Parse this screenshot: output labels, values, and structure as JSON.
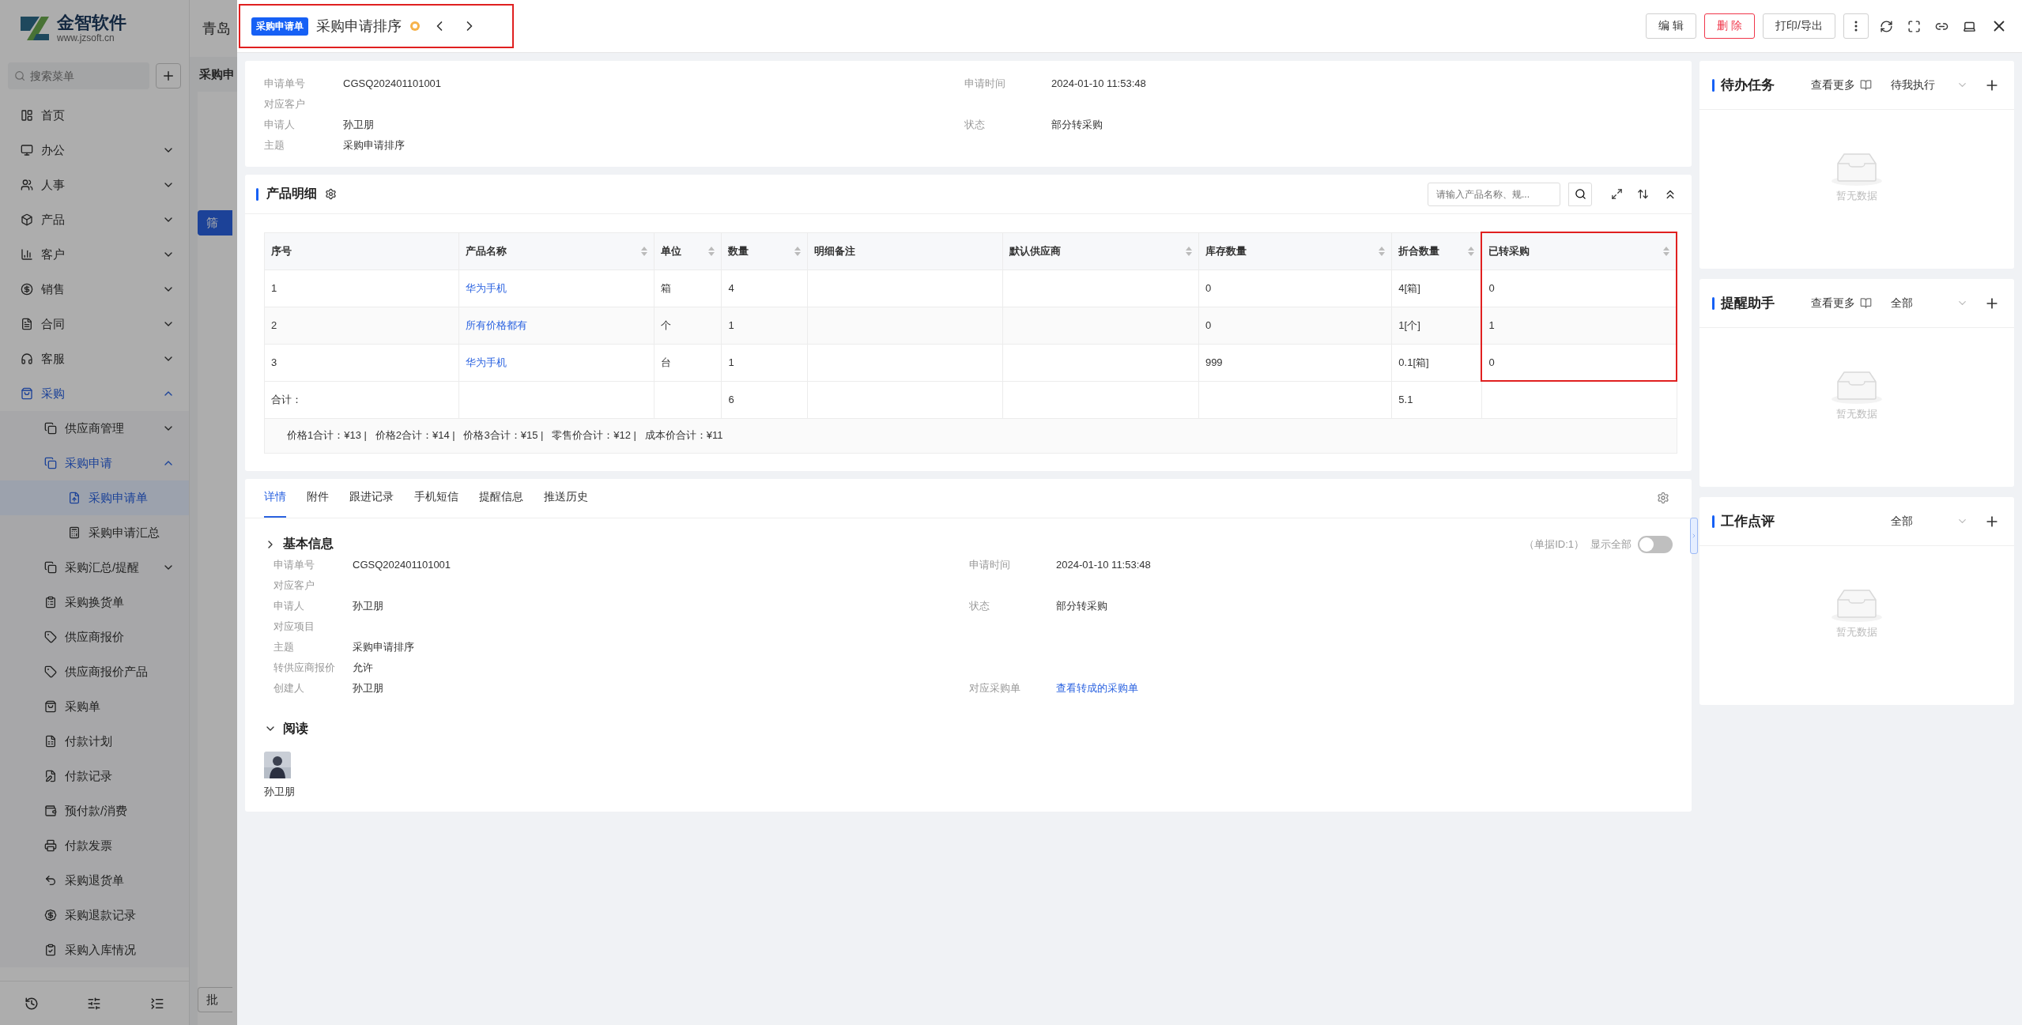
{
  "background_app": {
    "company": "青岛",
    "page_title": "采购申",
    "filter_button": "筛",
    "batch_button": "批"
  },
  "sidebar": {
    "logo": {
      "name": "金智软件",
      "url": "www.jzsoft.cn"
    },
    "search": {
      "placeholder": "搜索菜单"
    },
    "items": [
      {
        "label": "首页",
        "selected": false
      },
      {
        "label": "办公",
        "selected": false,
        "expanded": false
      },
      {
        "label": "人事",
        "selected": false,
        "expanded": false
      },
      {
        "label": "产品",
        "selected": false,
        "expanded": false
      },
      {
        "label": "客户",
        "selected": false,
        "expanded": false
      },
      {
        "label": "销售",
        "selected": false,
        "expanded": false
      },
      {
        "label": "合同",
        "selected": false,
        "expanded": false
      },
      {
        "label": "客服",
        "selected": false,
        "expanded": false
      },
      {
        "label": "采购",
        "selected": true,
        "expanded": true,
        "children": [
          {
            "label": "供应商管理",
            "selected": false,
            "expanded": false
          },
          {
            "label": "采购申请",
            "selected": true,
            "expanded": true,
            "children": [
              {
                "label": "采购申请单",
                "selected": true
              },
              {
                "label": "采购申请汇总",
                "selected": false
              }
            ]
          },
          {
            "label": "采购汇总/提醒",
            "selected": false,
            "expanded": false
          },
          {
            "label": "采购换货单",
            "selected": false
          },
          {
            "label": "供应商报价",
            "selected": false
          },
          {
            "label": "供应商报价产品",
            "selected": false
          },
          {
            "label": "采购单",
            "selected": false
          },
          {
            "label": "付款计划",
            "selected": false
          },
          {
            "label": "付款记录",
            "selected": false
          },
          {
            "label": "预付款/消费",
            "selected": false
          },
          {
            "label": "付款发票",
            "selected": false
          },
          {
            "label": "采购退货单",
            "selected": false
          },
          {
            "label": "采购退款记录",
            "selected": false
          },
          {
            "label": "采购入库情况",
            "selected": false
          }
        ]
      }
    ]
  },
  "header": {
    "highlighted": true,
    "tag": "采购申请单",
    "title": "采购申请排序",
    "buttons": [
      {
        "label": "编 辑",
        "kind": "default"
      },
      {
        "label": "删 除",
        "kind": "danger"
      },
      {
        "label": "打印/导出",
        "kind": "default"
      }
    ]
  },
  "summary": {
    "rows": [
      {
        "left": {
          "label": "申请单号",
          "value": "CGSQ202401101001"
        },
        "right": {
          "label": "申请时间",
          "value": "2024-01-10 11:53:48"
        }
      },
      {
        "left": {
          "label": "对应客户"
        }
      },
      {
        "left": {
          "label": "申请人",
          "value": "孙卫朋"
        },
        "right": {
          "label": "状态",
          "value": "部分转采购"
        }
      },
      {
        "left": {
          "label": "主题",
          "value": "采购申请排序"
        }
      }
    ]
  },
  "products": {
    "title": "产品明细",
    "search": {
      "placeholder": "请输入产品名称、规..."
    },
    "columns": [
      {
        "label": "序号",
        "sortable": false,
        "highlighted": false
      },
      {
        "label": "产品名称",
        "sortable": true,
        "highlighted": false,
        "kind": "link"
      },
      {
        "label": "单位",
        "sortable": true,
        "highlighted": false
      },
      {
        "label": "数量",
        "sortable": true,
        "highlighted": false,
        "total": "6"
      },
      {
        "label": "明细备注",
        "sortable": false,
        "highlighted": false
      },
      {
        "label": "默认供应商",
        "sortable": true,
        "highlighted": false
      },
      {
        "label": "库存数量",
        "sortable": true,
        "highlighted": false
      },
      {
        "label": "折合数量",
        "sortable": true,
        "highlighted": false,
        "total": "5.1"
      },
      {
        "label": "已转采购",
        "sortable": true,
        "highlighted": true
      }
    ],
    "rows": [
      [
        "1",
        "华为手机",
        "箱",
        "4",
        null,
        null,
        "0",
        "4[箱]",
        "0"
      ],
      [
        "2",
        "所有价格都有",
        "个",
        "1",
        null,
        null,
        "0",
        "1[个]",
        "1"
      ],
      [
        "3",
        "华为手机",
        "台",
        "1",
        null,
        null,
        "999",
        "0.1[箱]",
        "0"
      ]
    ],
    "total_label": "合计：",
    "price_totals": "价格1合计：¥13 |   价格2合计：¥14 |   价格3合计：¥15 |   零售价合计：¥12 |   成本价合计：¥11"
  },
  "tabs": [
    {
      "label": "详情",
      "selected": true
    },
    {
      "label": "附件",
      "selected": false
    },
    {
      "label": "跟进记录",
      "selected": false
    },
    {
      "label": "手机短信",
      "selected": false
    },
    {
      "label": "提醒信息",
      "selected": false
    },
    {
      "label": "推送历史",
      "selected": false
    }
  ],
  "basic_info": {
    "title": "基本信息",
    "expanded": false,
    "doc_id": "（单据ID:1）",
    "show_all": {
      "label": "显示全部",
      "on": false
    },
    "rows": [
      {
        "left": {
          "label": "申请单号",
          "value": "CGSQ202401101001"
        },
        "right": {
          "label": "申请时间",
          "value": "2024-01-10 11:53:48"
        }
      },
      {
        "left": {
          "label": "对应客户"
        }
      },
      {
        "left": {
          "label": "申请人",
          "value": "孙卫朋"
        },
        "right": {
          "label": "状态",
          "value": "部分转采购"
        }
      },
      {
        "left": {
          "label": "对应项目"
        }
      },
      {
        "left": {
          "label": "主题",
          "value": "采购申请排序"
        }
      },
      {
        "left": {
          "label": "转供应商报价",
          "value": "允许"
        }
      },
      {
        "left": {
          "label": "创建人",
          "value": "孙卫朋"
        },
        "right": {
          "label": "对应采购单",
          "value": "查看转成的采购单",
          "kind": "link"
        }
      }
    ]
  },
  "reading": {
    "title": "阅读",
    "expanded": true,
    "readers": [
      {
        "name": "孙卫朋",
        "kind": "picture"
      }
    ]
  },
  "panels": [
    {
      "title": "待办任务",
      "more": "查看更多",
      "filter": "待我执行",
      "empty": "暂无数据"
    },
    {
      "title": "提醒助手",
      "more": "查看更多",
      "filter": "全部",
      "empty": "暂无数据"
    },
    {
      "title": "工作点评",
      "filter": "全部",
      "empty": "暂无数据"
    }
  ]
}
